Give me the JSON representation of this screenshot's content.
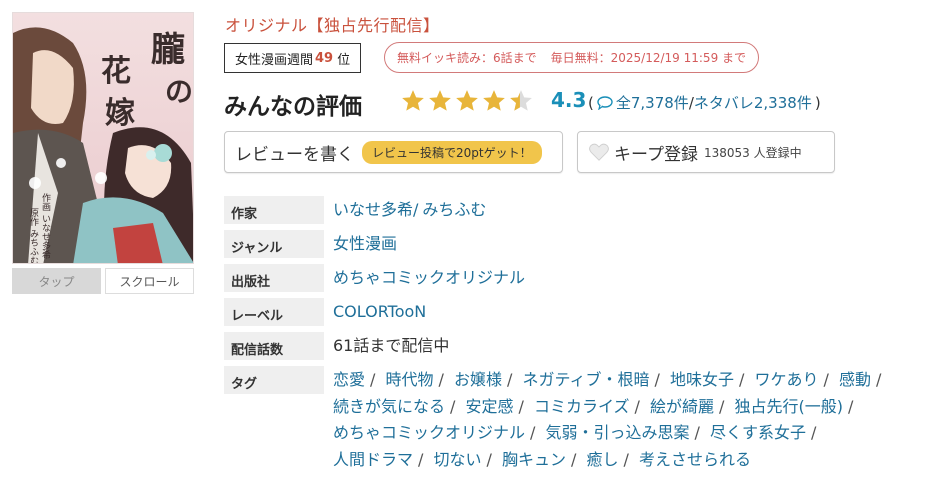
{
  "cover": {
    "title": "朧の花嫁",
    "author_credit": "作画 いなせ多希",
    "original_credit": "原作 みちふむ",
    "tabs": [
      {
        "label": "タップ",
        "active": true
      },
      {
        "label": "スクロール",
        "active": false
      }
    ]
  },
  "header": {
    "label": "オリジナル【独占先行配信】",
    "rank": {
      "prefix": "女性漫画週間",
      "number": "49",
      "suffix": "位"
    },
    "free": {
      "part1": "無料イッキ読み：6話まで",
      "part2": "毎日無料：2025/12/19 11:59 まで"
    }
  },
  "reviews": {
    "title": "みんなの評価",
    "rating": "4.3",
    "rating_value": 4.3,
    "open": "(",
    "total": "全7,378件",
    "slash": "/",
    "spoiler": "ネタバレ2,338件",
    "close": ")"
  },
  "actions": {
    "write_review": "レビューを書く",
    "promo": "レビュー投稿で20ptゲット！",
    "keep": "キープ登録",
    "keep_count": "138053 人登録中"
  },
  "info": {
    "author_key": "作家",
    "authors": [
      "いなせ多希",
      "みちふむ"
    ],
    "author_sep": "/",
    "genre_key": "ジャンル",
    "genre": "女性漫画",
    "publisher_key": "出版社",
    "publisher": "めちゃコミックオリジナル",
    "label_key": "レーベル",
    "label": "COLORTooN",
    "episodes_key": "配信話数",
    "episodes": "61話まで配信中",
    "tags_key": "タグ",
    "tags": [
      "恋愛",
      "時代物",
      "お嬢様",
      "ネガティブ・根暗",
      "地味女子",
      "ワケあり",
      "感動",
      "続きが気になる",
      "安定感",
      "コミカライズ",
      "絵が綺麗",
      "独占先行(一般)",
      "めちゃコミックオリジナル",
      "気弱・引っ込み思案",
      "尽くす系女子",
      "人間ドラマ",
      "切ない",
      "胸キュン",
      "癒し",
      "考えさせられる"
    ]
  },
  "colors": {
    "accent_red": "#c9513c",
    "link_blue": "#1f6f99",
    "rating_blue": "#1a8fb8",
    "star_gold": "#e8b53a",
    "promo_yellow": "#f1c54b"
  },
  "icons": {
    "star": "star-icon",
    "bubble": "speech-bubble-icon",
    "heart": "heart-icon"
  }
}
